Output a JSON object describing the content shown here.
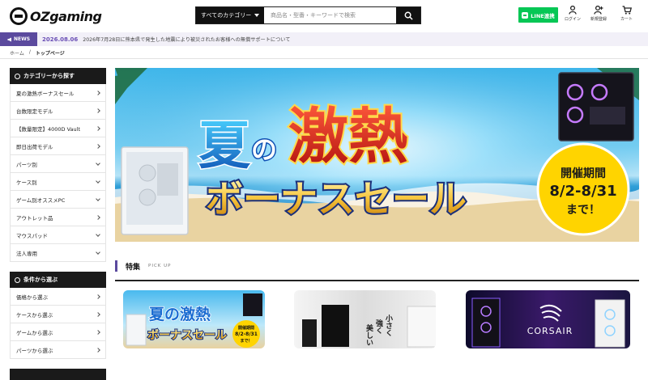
{
  "header": {
    "logo_text": "OZgaming",
    "search_category": "すべてのカテゴリー",
    "search_placeholder": "商品名・型番・キーワードで検索",
    "line_label": "LINE連携",
    "login_label": "ログイン",
    "register_label": "新規登録",
    "cart_label": "カート"
  },
  "news": {
    "tag": "NEWS",
    "date": "2026.08.06",
    "text": "2026年7月28日に熊本県で発生した地震により被災されたお客様への無償サポートについて"
  },
  "breadcrumb": {
    "home": "ホーム",
    "separator": "/",
    "current": "トップページ"
  },
  "sidebar": {
    "category_title": "カテゴリーから探す",
    "category_items": [
      {
        "label": "夏の激熱ボーナスセール",
        "arrow": "right"
      },
      {
        "label": "台数限定モデル",
        "arrow": "right"
      },
      {
        "label": "【数量限定】4000D Vault",
        "arrow": "right"
      },
      {
        "label": "即日出荷モデル",
        "arrow": "right"
      },
      {
        "label": "パーツ別",
        "arrow": "down"
      },
      {
        "label": "ケース別",
        "arrow": "down"
      },
      {
        "label": "ゲーム別オススメPC",
        "arrow": "down"
      },
      {
        "label": "アウトレット品",
        "arrow": "right"
      },
      {
        "label": "マウスパッド",
        "arrow": "down"
      },
      {
        "label": "法人専用",
        "arrow": "down"
      }
    ],
    "condition_title": "条件から選ぶ",
    "condition_items": [
      {
        "label": "価格から選ぶ",
        "arrow": "right"
      },
      {
        "label": "ケースから選ぶ",
        "arrow": "right"
      },
      {
        "label": "ゲームから選ぶ",
        "arrow": "right"
      },
      {
        "label": "パーツから選ぶ",
        "arrow": "right"
      }
    ]
  },
  "banner": {
    "line1_a": "夏",
    "line1_b": "の",
    "line1_c": "激熱",
    "line2": "ボーナスセール",
    "period_title": "開催期間",
    "period_dates": "8/2-8/31",
    "period_tail": "まで！"
  },
  "feature": {
    "title": "特集",
    "subtitle": "PICK UP",
    "cards": [
      {
        "line1": "夏の激熱",
        "line2": "ボーナスセール",
        "period_title": "開催期間",
        "period_dates": "8/2-8/31",
        "period_tail": "まで！"
      },
      {
        "v1": "小さく",
        "v2": "強く",
        "v3": "美しい"
      },
      {
        "brand": "CORSAIR"
      }
    ]
  },
  "colors": {
    "accent": "#5b4a9e",
    "line_green": "#06c755",
    "dark": "#1a1a1a"
  }
}
